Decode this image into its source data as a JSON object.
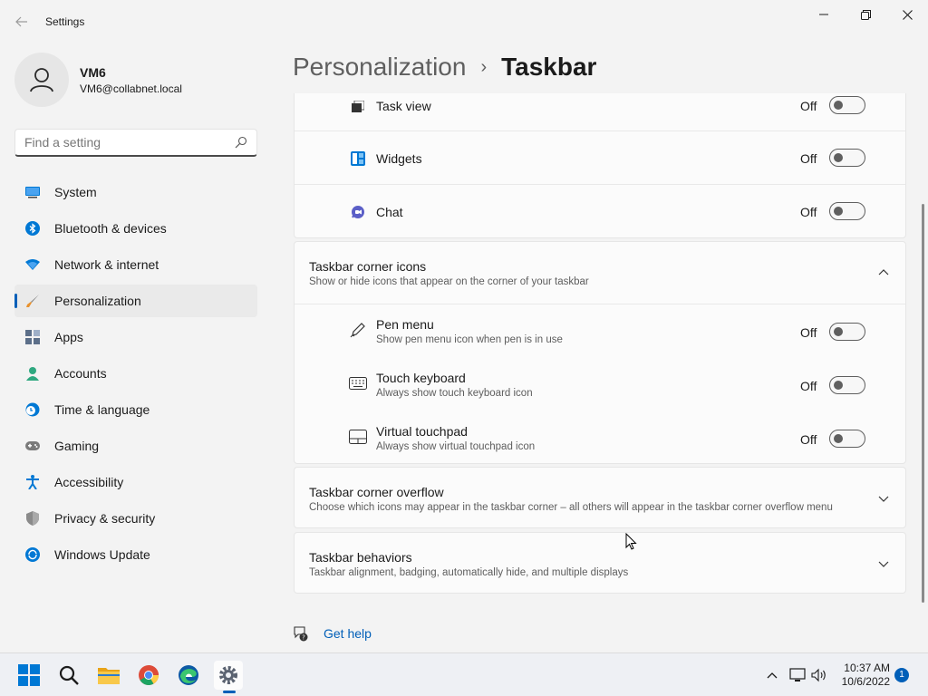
{
  "window": {
    "title": "Settings"
  },
  "profile": {
    "name": "VM6",
    "email": "VM6@collabnet.local"
  },
  "search": {
    "placeholder": "Find a setting"
  },
  "nav": [
    {
      "label": "System",
      "icon": "monitor-icon",
      "color": "#0078d4"
    },
    {
      "label": "Bluetooth & devices",
      "icon": "bluetooth-icon",
      "color": "#0078d4"
    },
    {
      "label": "Network & internet",
      "icon": "wifi-icon",
      "color": "#0078d4"
    },
    {
      "label": "Personalization",
      "icon": "brush-icon",
      "color": "#e8912d",
      "active": true
    },
    {
      "label": "Apps",
      "icon": "apps-icon",
      "color": "#5c6f89"
    },
    {
      "label": "Accounts",
      "icon": "person-icon",
      "color": "#2fa880"
    },
    {
      "label": "Time & language",
      "icon": "clock-globe-icon",
      "color": "#0078d4"
    },
    {
      "label": "Gaming",
      "icon": "gamepad-icon",
      "color": "#7a7a7a"
    },
    {
      "label": "Accessibility",
      "icon": "accessibility-icon",
      "color": "#0078d4"
    },
    {
      "label": "Privacy & security",
      "icon": "shield-icon",
      "color": "#8a8a8a"
    },
    {
      "label": "Windows Update",
      "icon": "update-icon",
      "color": "#0078d4"
    }
  ],
  "breadcrumb": {
    "parent": "Personalization",
    "separator": "›",
    "current": "Taskbar"
  },
  "taskbar_items": {
    "task_view": {
      "label": "Task view",
      "state": "Off"
    },
    "widgets": {
      "label": "Widgets",
      "state": "Off"
    },
    "chat": {
      "label": "Chat",
      "state": "Off"
    }
  },
  "corner_icons": {
    "title": "Taskbar corner icons",
    "desc": "Show or hide icons that appear on the corner of your taskbar",
    "pen_menu": {
      "label": "Pen menu",
      "desc": "Show pen menu icon when pen is in use",
      "state": "Off"
    },
    "touch_keyboard": {
      "label": "Touch keyboard",
      "desc": "Always show touch keyboard icon",
      "state": "Off"
    },
    "virtual_touchpad": {
      "label": "Virtual touchpad",
      "desc": "Always show virtual touchpad icon",
      "state": "Off"
    }
  },
  "corner_overflow": {
    "title": "Taskbar corner overflow",
    "desc": "Choose which icons may appear in the taskbar corner – all others will appear in the taskbar corner overflow menu"
  },
  "behaviors": {
    "title": "Taskbar behaviors",
    "desc": "Taskbar alignment, badging, automatically hide, and multiple displays"
  },
  "help": {
    "label": "Get help"
  },
  "taskbar": {
    "time": "10:37 AM",
    "date": "10/6/2022",
    "notification_count": "1",
    "apps": [
      "start-icon",
      "search-icon",
      "file-explorer-icon",
      "chrome-icon",
      "edge-icon",
      "settings-icon"
    ]
  },
  "colors": {
    "accent": "#005fb8",
    "background": "#f3f3f3",
    "card": "#fbfbfb"
  }
}
